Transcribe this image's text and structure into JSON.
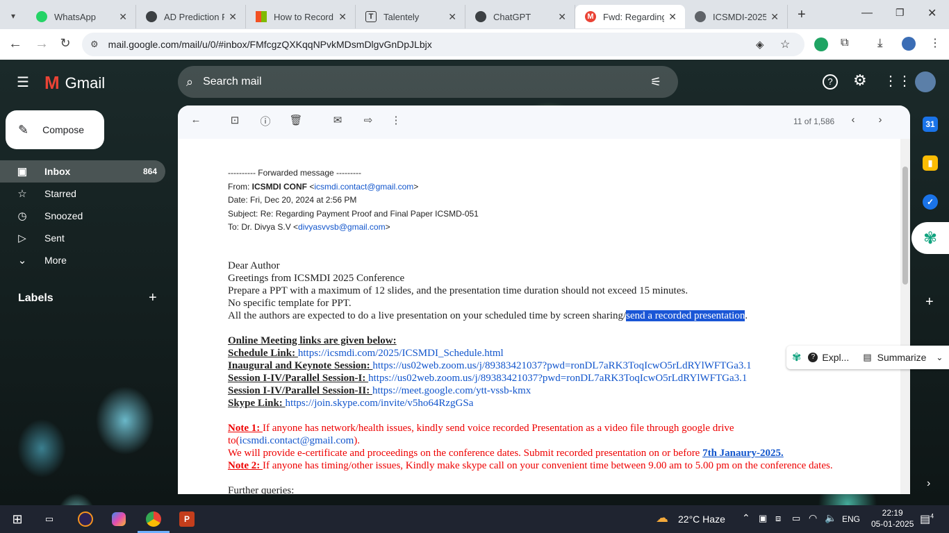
{
  "tabs": [
    {
      "title": "WhatsApp",
      "icon": "whatsapp-icon",
      "color": "#25d366"
    },
    {
      "title": "AD Prediction Fr",
      "icon": "chatgpt-icon",
      "color": "#3c4043"
    },
    {
      "title": "How to Record Y",
      "icon": "microsoft-icon",
      "color": "#f25022"
    },
    {
      "title": "Talentely",
      "icon": "talentely-icon",
      "color": "#3c4043"
    },
    {
      "title": "ChatGPT",
      "icon": "chatgpt-icon",
      "color": "#3c4043"
    },
    {
      "title": "Fwd: Regarding",
      "icon": "gmail-icon",
      "color": "#ea4335",
      "active": true
    },
    {
      "title": "ICSMDI-2025",
      "icon": "globe-icon",
      "color": "#5f6368"
    }
  ],
  "address": {
    "url": "mail.google.com/mail/u/0/#inbox/FMfcgzQXKqqNPvkMDsmDlgvGnDpJLbjx"
  },
  "gmail": {
    "logo_text": "Gmail",
    "search_placeholder": "Search mail",
    "compose_label": "Compose",
    "labels_heading": "Labels",
    "nav": [
      {
        "label": "Inbox",
        "count": "864",
        "icon": "inbox-icon"
      },
      {
        "label": "Starred",
        "count": "",
        "icon": "star-icon"
      },
      {
        "label": "Snoozed",
        "count": "",
        "icon": "clock-icon"
      },
      {
        "label": "Sent",
        "count": "",
        "icon": "send-icon"
      },
      {
        "label": "More",
        "count": "",
        "icon": "chevron-down-icon"
      }
    ],
    "pager": "11 of 1,586"
  },
  "email": {
    "forward_line": "---------- Forwarded message ---------",
    "from_label": "From: ",
    "from_name": "ICSMDI CONF",
    "from_email": "icsmdi.contact@gmail.com",
    "date": "Date: Fri, Dec 20, 2024 at 2:56 PM",
    "subject": "Subject: Re: Regarding Payment Proof and Final Paper ICSMD-051",
    "to_label": "To: Dr. Divya S.V <",
    "to_email": "divyasvvsb@gmail.com",
    "line1": "Dear Author",
    "line2": "Greetings from ICSMDI 2025 Conference",
    "line3": "Prepare a PPT with a maximum of 12 slides, and the presentation time duration should not exceed 15 minutes.",
    "line4": "No specific template for PPT.",
    "line5_a": "All the authors are expected to do a live presentation on your scheduled time by screen sharing/",
    "line5_hl": "send a recorded presentation",
    "line5_b": ".",
    "links_heading": "Online Meeting links are given below:",
    "links": [
      {
        "label": "Schedule Link: ",
        "url": "https://icsmdi.com/2025/ICSMDI_Schedule.html"
      },
      {
        "label": "Inaugural and Keynote Session:  ",
        "url": "https://us02web.zoom.us/j/89383421037?pwd=ronDL7aRK3ToqIcwO5rLdRYlWFTGa3.1"
      },
      {
        "label": "Session I-IV/Parallel Session-I: ",
        "url": "https://us02web.zoom.us/j/89383421037?pwd=ronDL7aRK3ToqIcwO5rLdRYlWFTGa3.1"
      },
      {
        "label": "Session I-IV/Parallel Session-II: ",
        "url": "https://meet.google.com/ytt-vssb-kmx"
      },
      {
        "label": "Skype Link: ",
        "url": "https://join.skype.com/invite/v5ho64RzgGSa"
      }
    ],
    "note1_label": "Note 1: ",
    "note1_text": "If anyone has network/health issues, kindly send voice recorded Presentation as a video file through google drive",
    "note1_to": "to(",
    "note1_email": "icsmdi.contact@gmail.com",
    "note1_end": ").",
    "cert_text": "We will provide e-certificate and proceedings on the conference dates. Submit recorded presentation on or before ",
    "cert_date": "7th Janaury-2025.",
    "note2_label": "Note 2: ",
    "note2_text": "If anyone has timing/other issues, Kindly make skype call on your convenient time between 9.00 am to 5.00 pm on the conference dates.",
    "further": "Further queries:"
  },
  "ai_popup": {
    "explain": "Expl...",
    "summarize": "Summarize"
  },
  "taskbar": {
    "weather": "22°C  Haze",
    "lang": "ENG",
    "time": "22:19",
    "date": "05-01-2025",
    "notifications": "4"
  },
  "colors": {
    "gmail_red": "#ea4335",
    "link": "#1155cc",
    "highlight": "#1a56d6",
    "note_red": "#ee0000"
  }
}
